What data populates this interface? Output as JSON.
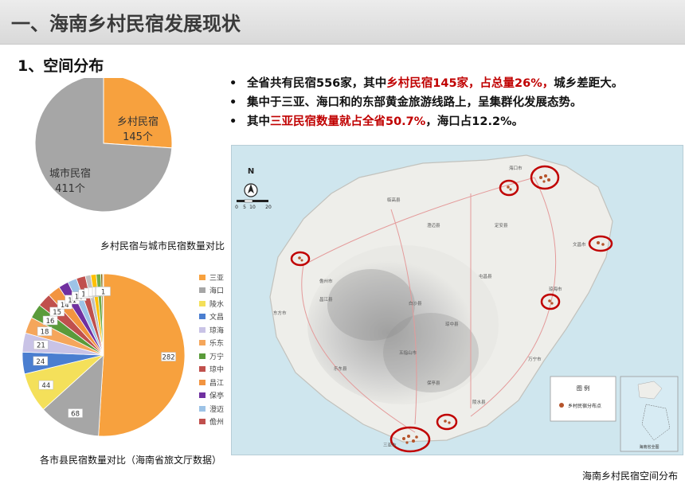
{
  "header": {
    "title": "一、海南乡村民宿发展现状"
  },
  "section": {
    "title": "1、空间分布"
  },
  "bullets": [
    {
      "parts": [
        {
          "text": "全省共有民宿556家，其中",
          "hl": false
        },
        {
          "text": "乡村民宿145家，占总量26%，",
          "hl": true
        },
        {
          "text": "城乡差距大。",
          "hl": false
        }
      ]
    },
    {
      "parts": [
        {
          "text": "集中于三亚、海口和的东部黄金旅游线路上，呈集群化发展态势。",
          "hl": false
        }
      ]
    },
    {
      "parts": [
        {
          "text": "其中",
          "hl": false
        },
        {
          "text": "三亚民宿数量就占全省50.7%",
          "hl": true
        },
        {
          "text": "，海口占12.2%。",
          "hl": false
        }
      ]
    }
  ],
  "pie1": {
    "caption": "乡村民宿与城市民宿数量对比",
    "slices": [
      {
        "name": "乡村民宿",
        "count": "145个",
        "value": 145,
        "color": "#f7a13e"
      },
      {
        "name": "城市民宿",
        "count": "411个",
        "value": 411,
        "color": "#a6a6a6"
      }
    ]
  },
  "chart_data": {
    "type": "pie",
    "title": "",
    "categories": [
      "三亚",
      "海口",
      "陵水",
      "文昌",
      "琼海",
      "乐东",
      "万宁",
      "琼中",
      "昌江",
      "保亭",
      "澄迈",
      "儋州",
      "",
      "",
      "",
      "",
      ""
    ],
    "values": [
      282,
      68,
      44,
      24,
      21,
      18,
      16,
      15,
      14,
      11,
      10,
      10,
      6,
      6,
      5,
      2,
      1
    ],
    "colors": [
      "#f7a13e",
      "#a6a6a6",
      "#f4e05a",
      "#4a7ed0",
      "#c9c3e6",
      "#f5a65b",
      "#5a9b3a",
      "#c0504d",
      "#f29440",
      "#7030a0",
      "#9dc3e6",
      "#c0504d",
      "#bfbfbf",
      "#ffc000",
      "#70ad47",
      "#7f6000",
      "#d9d9d9"
    ],
    "labels": [
      "282",
      "68",
      "44",
      "24",
      "21",
      "18",
      "16",
      "15",
      "14",
      "11",
      "10",
      "10",
      "6",
      "6",
      "5",
      "2",
      "1"
    ],
    "legend_placement": "right"
  },
  "pie2": {
    "caption": "各市县民宿数量对比（海南省旅文厅数据）"
  },
  "map": {
    "caption": "海南乡村民宿空间分布",
    "north": "N",
    "scale": [
      "0",
      "5",
      "10",
      "20"
    ],
    "legend_title": "图  例",
    "legend_item": "乡村民宿分布点",
    "inset_label": "海南省全图",
    "places": [
      "临高县",
      "澄迈县",
      "定安县",
      "儋州市",
      "屯昌县",
      "琼海市",
      "白沙县",
      "东方市",
      "琼中县",
      "五指山市",
      "万宁市",
      "乐东县",
      "保亭县",
      "陵水县",
      "三亚市",
      "文昌市",
      "海口市",
      "昌江县"
    ]
  }
}
